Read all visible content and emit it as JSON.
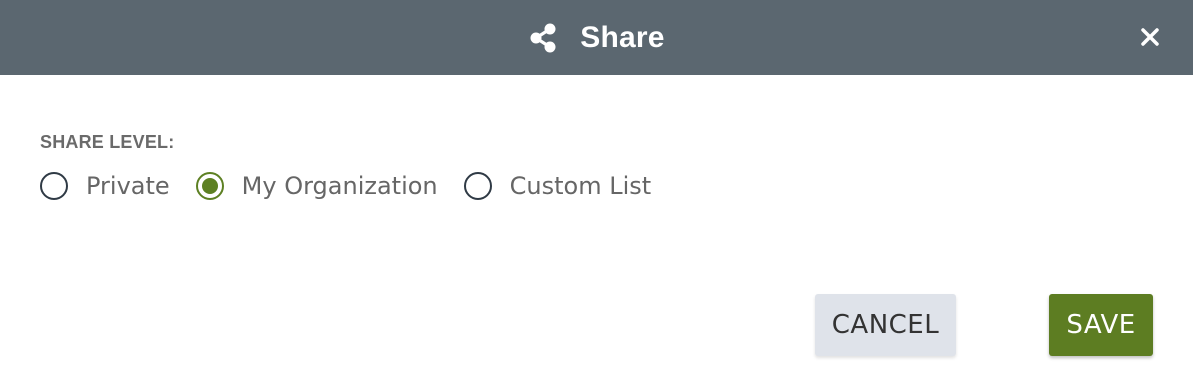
{
  "dialog": {
    "title": "Share",
    "header_icon": "share-icon",
    "close_icon": "close-icon",
    "colors": {
      "header_bg": "#5b6770",
      "accent_green": "#5d8023",
      "cancel_bg": "#dfe3ea"
    }
  },
  "share_level": {
    "label": "SHARE LEVEL:",
    "options": [
      {
        "label": "Private",
        "selected": false
      },
      {
        "label": "My Organization",
        "selected": true
      },
      {
        "label": "Custom List",
        "selected": false
      }
    ]
  },
  "buttons": {
    "cancel_label": "CANCEL",
    "save_label": "SAVE"
  }
}
